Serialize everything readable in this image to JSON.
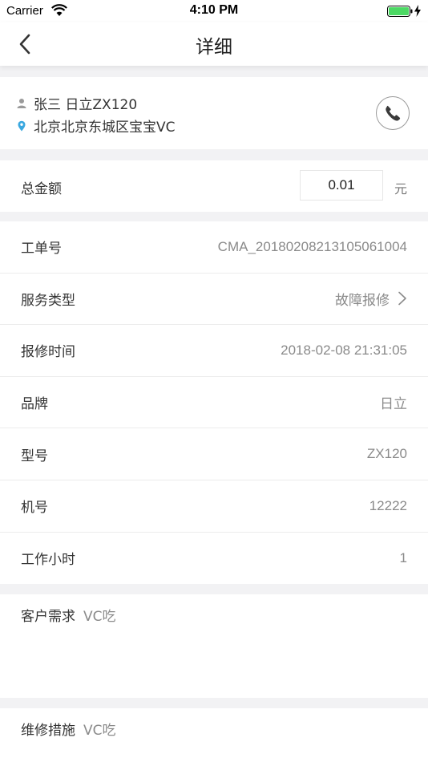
{
  "status_bar": {
    "carrier": "Carrier",
    "time": "4:10 PM",
    "battery_color": "#4cd964"
  },
  "nav": {
    "title": "详细"
  },
  "customer": {
    "name_model": "张三 日立ZX120",
    "address": "北京北京东城区宝宝VC",
    "person_icon": "person-icon",
    "location_icon": "location-pin-icon",
    "location_color": "#3aa8e0",
    "call_icon": "phone-icon"
  },
  "amount": {
    "label": "总金额",
    "value": "0.01",
    "unit": "元"
  },
  "details": {
    "rows": [
      {
        "label": "工单号",
        "value": "CMA_20180208213105061004"
      },
      {
        "label": "服务类型",
        "value": "故障报修"
      },
      {
        "label": "报修时间",
        "value": "2018-02-08 21:31:05"
      },
      {
        "label": "品牌",
        "value": "日立"
      },
      {
        "label": "型号",
        "value": "ZX120"
      },
      {
        "label": "机号",
        "value": "12222"
      },
      {
        "label": "工作小时",
        "value": "1"
      }
    ]
  },
  "demand": {
    "label": "客户需求",
    "value": "VC吃"
  },
  "repair": {
    "label": "维修措施",
    "value": "VC吃"
  }
}
